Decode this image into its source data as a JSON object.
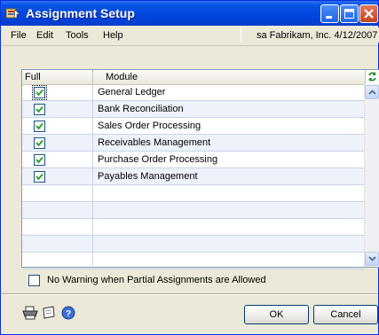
{
  "window": {
    "title": "Assignment Setup",
    "accent_color": "#0a54e3",
    "controls": {
      "minimize": "minimize-icon",
      "maximize": "maximize-icon",
      "close": "close-icon"
    }
  },
  "menu": {
    "items": [
      "File",
      "Edit",
      "Tools",
      "Help"
    ],
    "company_label": "sa  Fabrikam, Inc.  4/12/2007"
  },
  "grid": {
    "columns": [
      "Full",
      "Module"
    ],
    "rows": [
      {
        "full": true,
        "module": "General Ledger"
      },
      {
        "full": true,
        "module": "Bank Reconciliation"
      },
      {
        "full": true,
        "module": "Sales Order Processing"
      },
      {
        "full": true,
        "module": "Receivables Management"
      },
      {
        "full": true,
        "module": "Purchase Order Processing"
      },
      {
        "full": true,
        "module": "Payables Management"
      },
      {
        "full": false,
        "module": ""
      },
      {
        "full": false,
        "module": ""
      },
      {
        "full": false,
        "module": ""
      },
      {
        "full": false,
        "module": ""
      },
      {
        "full": false,
        "module": ""
      }
    ]
  },
  "options": {
    "no_warning_label": "No Warning when Partial Assignments are Allowed",
    "no_warning_checked": false
  },
  "footer": {
    "icons": [
      "printer-icon",
      "note-icon",
      "help-icon"
    ],
    "ok_label": "OK",
    "cancel_label": "Cancel"
  }
}
